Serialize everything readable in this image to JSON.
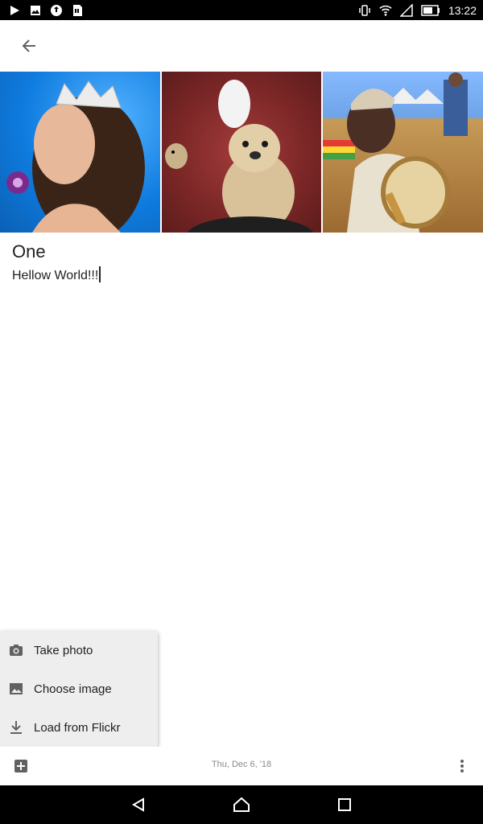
{
  "status_bar": {
    "time": "13:22",
    "icons": [
      "play-icon",
      "image-icon",
      "sync-icon",
      "sim-icon",
      "vibrate-icon",
      "wifi-icon",
      "signal-icon",
      "battery-icon"
    ]
  },
  "app_bar": {
    "back_icon": "arrow-back-icon"
  },
  "images": [
    {
      "name": "crowned-woman-photo"
    },
    {
      "name": "dog-photo"
    },
    {
      "name": "drummer-photo"
    }
  ],
  "note": {
    "title": "One",
    "body": "Hellow World!!!"
  },
  "menu": {
    "items": [
      {
        "label": "Take photo",
        "icon": "camera-icon"
      },
      {
        "label": "Choose image",
        "icon": "image-icon"
      },
      {
        "label": "Load from Flickr",
        "icon": "download-icon"
      }
    ]
  },
  "bottom_bar": {
    "add_icon": "add-box-icon",
    "date": "Thu, Dec 6, '18",
    "more_icon": "more-vert-icon"
  },
  "nav_bar": {
    "icons": [
      "nav-back-icon",
      "nav-home-icon",
      "nav-recent-icon"
    ]
  }
}
